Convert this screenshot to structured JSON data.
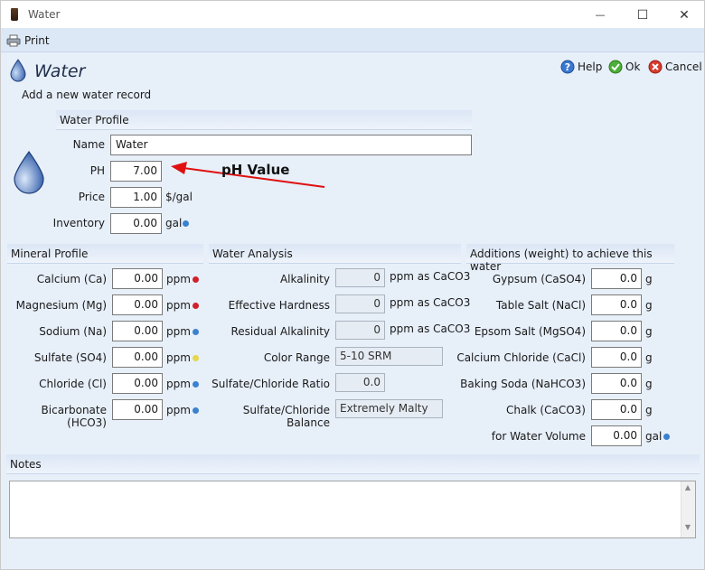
{
  "window": {
    "title": "Water",
    "minimize": "—",
    "maximize": "☐",
    "close": "✕"
  },
  "toolbar": {
    "print_label": "Print"
  },
  "header": {
    "title": "Water",
    "subtitle": "Add a new water record"
  },
  "actions": {
    "help": "Help",
    "ok": "Ok",
    "cancel": "Cancel"
  },
  "water_profile": {
    "section_title": "Water Profile",
    "name_label": "Name",
    "name_value": "Water",
    "ph_label": "PH",
    "ph_value": "7.00",
    "price_label": "Price",
    "price_value": "1.00",
    "price_unit": "$/gal",
    "inventory_label": "Inventory",
    "inventory_value": "0.00",
    "inventory_unit": "gal"
  },
  "annotation": {
    "text": "pH Value",
    "color": "#e01010"
  },
  "mineral_profile": {
    "section_title": "Mineral Profile",
    "unit": "ppm",
    "rows": [
      {
        "label": "Calcium (Ca)",
        "value": "0.00",
        "dot_color": "#d0202a"
      },
      {
        "label": "Magnesium (Mg)",
        "value": "0.00",
        "dot_color": "#d0202a"
      },
      {
        "label": "Sodium (Na)",
        "value": "0.00",
        "dot_color": "#3a82d0"
      },
      {
        "label": "Sulfate (SO4)",
        "value": "0.00",
        "dot_color": "#e6d84a"
      },
      {
        "label": "Chloride (Cl)",
        "value": "0.00",
        "dot_color": "#3a82d0"
      },
      {
        "label": "Bicarbonate (HCO3)",
        "value": "0.00",
        "dot_color": "#3a82d0"
      }
    ]
  },
  "water_analysis": {
    "section_title": "Water Analysis",
    "rows": [
      {
        "label": "Alkalinity",
        "value": "0",
        "unit": "ppm as CaCO3"
      },
      {
        "label": "Effective Hardness",
        "value": "0",
        "unit": "ppm as CaCO3"
      },
      {
        "label": "Residual Alkalinity",
        "value": "0",
        "unit": "ppm as CaCO3"
      },
      {
        "label": "Color Range",
        "value": "5-10 SRM",
        "unit": ""
      },
      {
        "label": "Sulfate/Chloride Ratio",
        "value": "0.0",
        "unit": ""
      },
      {
        "label": "Sulfate/Chloride Balance",
        "value": "Extremely Malty",
        "unit": ""
      }
    ]
  },
  "additions": {
    "section_title": "Additions (weight) to achieve this water",
    "unit": "g",
    "rows": [
      {
        "label": "Gypsum (CaSO4)",
        "value": "0.0"
      },
      {
        "label": "Table Salt (NaCl)",
        "value": "0.0"
      },
      {
        "label": "Epsom Salt (MgSO4)",
        "value": "0.0"
      },
      {
        "label": "Calcium Chloride (CaCl)",
        "value": "0.0"
      },
      {
        "label": "Baking Soda (NaHCO3)",
        "value": "0.0"
      },
      {
        "label": "Chalk (CaCO3)",
        "value": "0.0"
      }
    ],
    "volume_label": "for Water Volume",
    "volume_value": "0.00",
    "volume_unit": "gal"
  },
  "notes": {
    "section_title": "Notes",
    "value": ""
  },
  "colors": {
    "accent": "#1f5fa8",
    "panel": "#e7eff9",
    "section": "#dbe6f5"
  }
}
